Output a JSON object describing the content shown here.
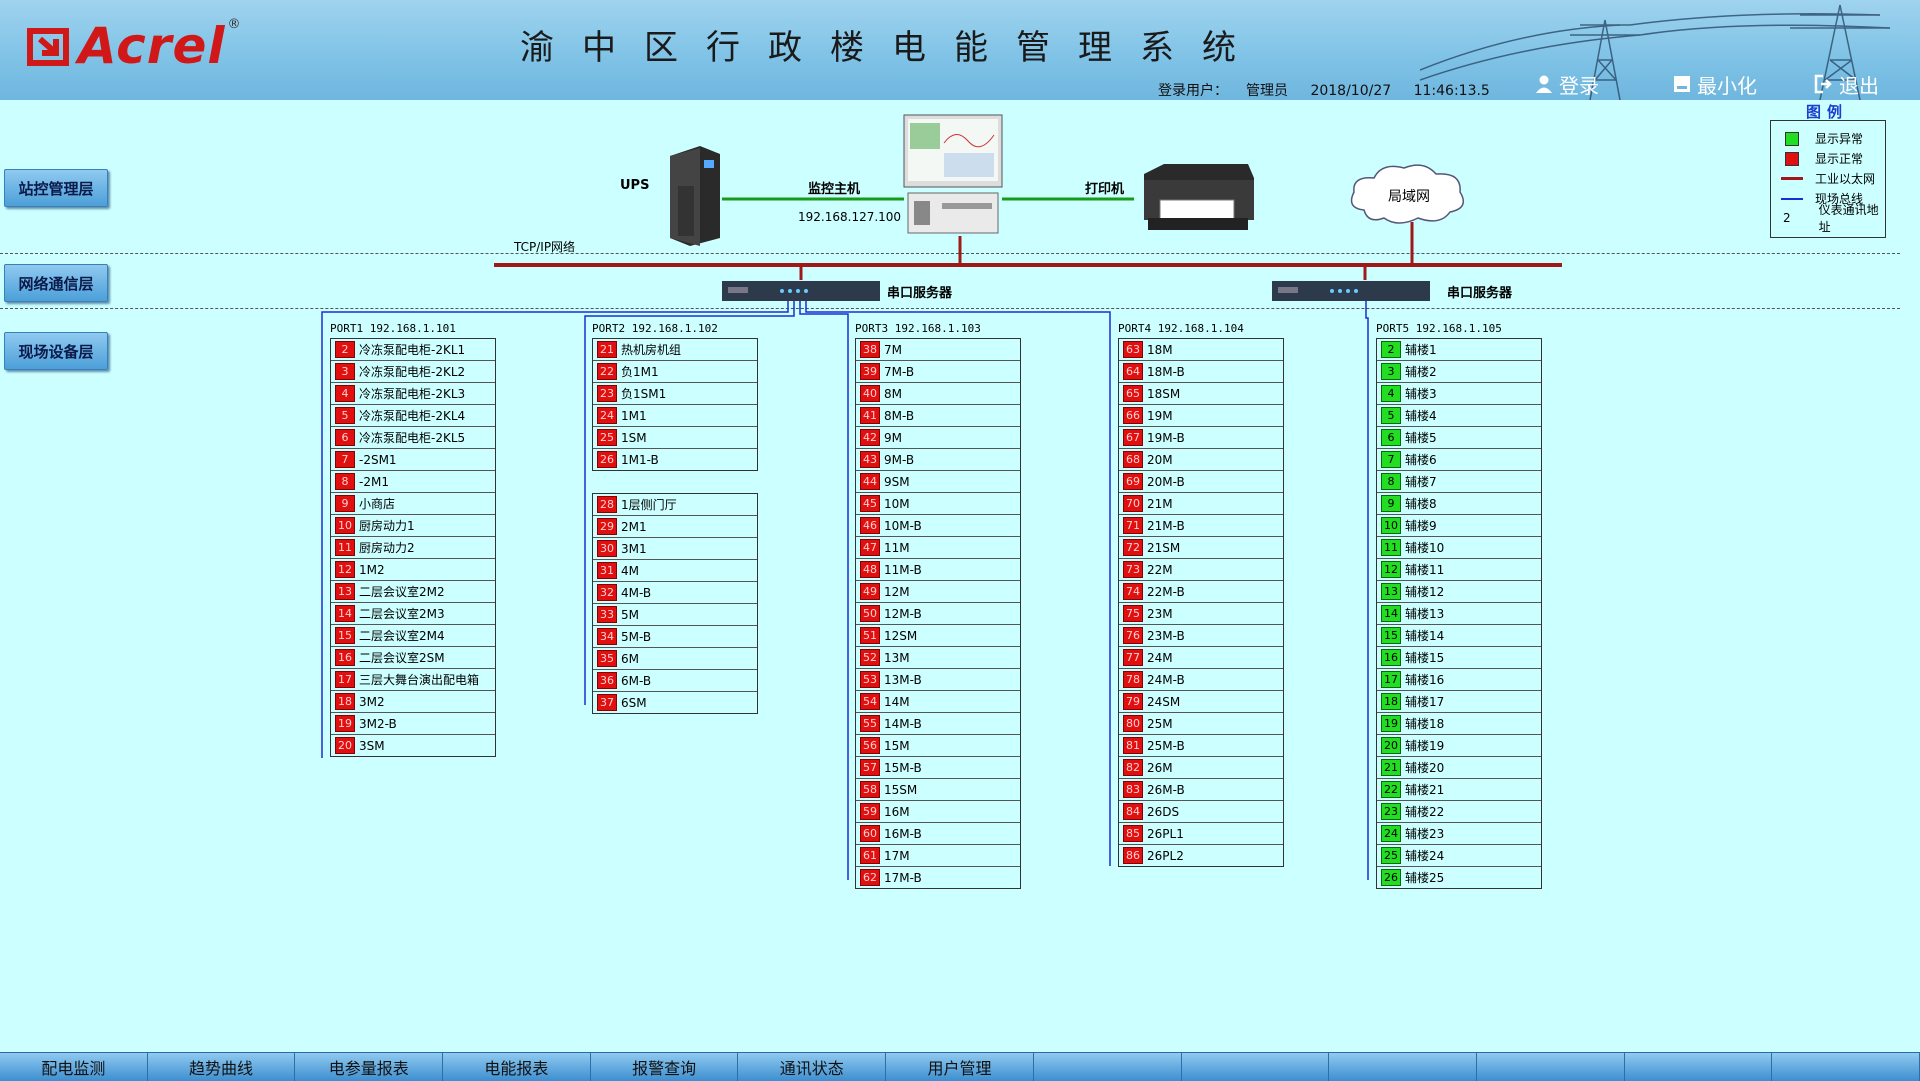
{
  "header": {
    "brand": "Acrel",
    "reg_mark": "®",
    "title": "渝中区行政楼电能管理系统",
    "user_label": "登录用户：",
    "user_name": "管理员",
    "date": "2018/10/27",
    "time": "11:46:13.5",
    "login_label": "登录",
    "minimize_label": "最小化",
    "exit_label": "退出"
  },
  "layers": {
    "station": "站控管理层",
    "network": "网络通信层",
    "field": "现场设备层"
  },
  "equipment": {
    "ups_label": "UPS",
    "host_label": "监控主机",
    "host_ip": "192.168.127.100",
    "printer_label": "打印机",
    "lan_label": "局域网",
    "tcpip_label": "TCP/IP网络",
    "serial_server_1": "串口服务器",
    "serial_server_2": "串口服务器"
  },
  "legend": {
    "title": "图例",
    "items": [
      {
        "symbol": "green-square",
        "label": "显示异常"
      },
      {
        "symbol": "red-square",
        "label": "显示正常"
      },
      {
        "symbol": "red-line",
        "label": "工业以太网"
      },
      {
        "symbol": "blue-line",
        "label": "现场总线"
      },
      {
        "symbol": "2",
        "label": "仪表通讯地址"
      }
    ]
  },
  "colors": {
    "status_red": "#e01010",
    "status_green": "#22dd22",
    "ethernet": "#a01818",
    "fieldbus": "#1a2fd0",
    "background": "#ccffff"
  },
  "ports": [
    {
      "title": "PORT1 192.168.1.101",
      "groups": [
        [
          {
            "n": "2",
            "t": "冷冻泵配电柜-2KL1",
            "s": "red"
          },
          {
            "n": "3",
            "t": "冷冻泵配电柜-2KL2",
            "s": "red"
          },
          {
            "n": "4",
            "t": "冷冻泵配电柜-2KL3",
            "s": "red"
          },
          {
            "n": "5",
            "t": "冷冻泵配电柜-2KL4",
            "s": "red"
          },
          {
            "n": "6",
            "t": "冷冻泵配电柜-2KL5",
            "s": "red"
          },
          {
            "n": "7",
            "t": "-2SM1",
            "s": "red"
          },
          {
            "n": "8",
            "t": "-2M1",
            "s": "red"
          },
          {
            "n": "9",
            "t": "小商店",
            "s": "red"
          },
          {
            "n": "10",
            "t": "厨房动力1",
            "s": "red"
          },
          {
            "n": "11",
            "t": "厨房动力2",
            "s": "red"
          },
          {
            "n": "12",
            "t": "1M2",
            "s": "red"
          },
          {
            "n": "13",
            "t": "二层会议室2M2",
            "s": "red"
          },
          {
            "n": "14",
            "t": "二层会议室2M3",
            "s": "red"
          },
          {
            "n": "15",
            "t": "二层会议室2M4",
            "s": "red"
          },
          {
            "n": "16",
            "t": "二层会议室2SM",
            "s": "red"
          },
          {
            "n": "17",
            "t": "三层大舞台演出配电箱",
            "s": "red"
          },
          {
            "n": "18",
            "t": "3M2",
            "s": "red"
          },
          {
            "n": "19",
            "t": "3M2-B",
            "s": "red"
          },
          {
            "n": "20",
            "t": "3SM",
            "s": "red"
          }
        ]
      ]
    },
    {
      "title": "PORT2 192.168.1.102",
      "groups": [
        [
          {
            "n": "21",
            "t": "热机房机组",
            "s": "red"
          },
          {
            "n": "22",
            "t": "负1M1",
            "s": "red"
          },
          {
            "n": "23",
            "t": "负1SM1",
            "s": "red"
          },
          {
            "n": "24",
            "t": "1M1",
            "s": "red"
          },
          {
            "n": "25",
            "t": "1SM",
            "s": "red"
          },
          {
            "n": "26",
            "t": "1M1-B",
            "s": "red"
          }
        ],
        [
          {
            "n": "28",
            "t": "1层侧门厅",
            "s": "red"
          },
          {
            "n": "29",
            "t": "2M1",
            "s": "red"
          },
          {
            "n": "30",
            "t": "3M1",
            "s": "red"
          },
          {
            "n": "31",
            "t": "4M",
            "s": "red"
          },
          {
            "n": "32",
            "t": "4M-B",
            "s": "red"
          },
          {
            "n": "33",
            "t": "5M",
            "s": "red"
          },
          {
            "n": "34",
            "t": "5M-B",
            "s": "red"
          },
          {
            "n": "35",
            "t": "6M",
            "s": "red"
          },
          {
            "n": "36",
            "t": "6M-B",
            "s": "red"
          },
          {
            "n": "37",
            "t": "6SM",
            "s": "red"
          }
        ]
      ]
    },
    {
      "title": "PORT3 192.168.1.103",
      "groups": [
        [
          {
            "n": "38",
            "t": "7M",
            "s": "red"
          },
          {
            "n": "39",
            "t": "7M-B",
            "s": "red"
          },
          {
            "n": "40",
            "t": "8M",
            "s": "red"
          },
          {
            "n": "41",
            "t": "8M-B",
            "s": "red"
          },
          {
            "n": "42",
            "t": "9M",
            "s": "red"
          },
          {
            "n": "43",
            "t": "9M-B",
            "s": "red"
          },
          {
            "n": "44",
            "t": "9SM",
            "s": "red"
          },
          {
            "n": "45",
            "t": "10M",
            "s": "red"
          },
          {
            "n": "46",
            "t": "10M-B",
            "s": "red"
          },
          {
            "n": "47",
            "t": "11M",
            "s": "red"
          },
          {
            "n": "48",
            "t": "11M-B",
            "s": "red"
          },
          {
            "n": "49",
            "t": "12M",
            "s": "red"
          },
          {
            "n": "50",
            "t": "12M-B",
            "s": "red"
          },
          {
            "n": "51",
            "t": "12SM",
            "s": "red"
          },
          {
            "n": "52",
            "t": "13M",
            "s": "red"
          },
          {
            "n": "53",
            "t": "13M-B",
            "s": "red"
          },
          {
            "n": "54",
            "t": "14M",
            "s": "red"
          },
          {
            "n": "55",
            "t": "14M-B",
            "s": "red"
          },
          {
            "n": "56",
            "t": "15M",
            "s": "red"
          },
          {
            "n": "57",
            "t": "15M-B",
            "s": "red"
          },
          {
            "n": "58",
            "t": "15SM",
            "s": "red"
          },
          {
            "n": "59",
            "t": "16M",
            "s": "red"
          },
          {
            "n": "60",
            "t": "16M-B",
            "s": "red"
          },
          {
            "n": "61",
            "t": "17M",
            "s": "red"
          },
          {
            "n": "62",
            "t": "17M-B",
            "s": "red"
          }
        ]
      ]
    },
    {
      "title": "PORT4 192.168.1.104",
      "groups": [
        [
          {
            "n": "63",
            "t": "18M",
            "s": "red"
          },
          {
            "n": "64",
            "t": "18M-B",
            "s": "red"
          },
          {
            "n": "65",
            "t": "18SM",
            "s": "red"
          },
          {
            "n": "66",
            "t": "19M",
            "s": "red"
          },
          {
            "n": "67",
            "t": "19M-B",
            "s": "red"
          },
          {
            "n": "68",
            "t": "20M",
            "s": "red"
          },
          {
            "n": "69",
            "t": "20M-B",
            "s": "red"
          },
          {
            "n": "70",
            "t": "21M",
            "s": "red"
          },
          {
            "n": "71",
            "t": "21M-B",
            "s": "red"
          },
          {
            "n": "72",
            "t": "21SM",
            "s": "red"
          },
          {
            "n": "73",
            "t": "22M",
            "s": "red"
          },
          {
            "n": "74",
            "t": "22M-B",
            "s": "red"
          },
          {
            "n": "75",
            "t": "23M",
            "s": "red"
          },
          {
            "n": "76",
            "t": "23M-B",
            "s": "red"
          },
          {
            "n": "77",
            "t": "24M",
            "s": "red"
          },
          {
            "n": "78",
            "t": "24M-B",
            "s": "red"
          },
          {
            "n": "79",
            "t": "24SM",
            "s": "red"
          },
          {
            "n": "80",
            "t": "25M",
            "s": "red"
          },
          {
            "n": "81",
            "t": "25M-B",
            "s": "red"
          },
          {
            "n": "82",
            "t": "26M",
            "s": "red"
          },
          {
            "n": "83",
            "t": "26M-B",
            "s": "red"
          },
          {
            "n": "84",
            "t": "26DS",
            "s": "red"
          },
          {
            "n": "85",
            "t": "26PL1",
            "s": "red"
          },
          {
            "n": "86",
            "t": "26PL2",
            "s": "red"
          }
        ]
      ]
    },
    {
      "title": "PORT5 192.168.1.105",
      "groups": [
        [
          {
            "n": "2",
            "t": "辅楼1",
            "s": "green"
          },
          {
            "n": "3",
            "t": "辅楼2",
            "s": "green"
          },
          {
            "n": "4",
            "t": "辅楼3",
            "s": "green"
          },
          {
            "n": "5",
            "t": "辅楼4",
            "s": "green"
          },
          {
            "n": "6",
            "t": "辅楼5",
            "s": "green"
          },
          {
            "n": "7",
            "t": "辅楼6",
            "s": "green"
          },
          {
            "n": "8",
            "t": "辅楼7",
            "s": "green"
          },
          {
            "n": "9",
            "t": "辅楼8",
            "s": "green"
          },
          {
            "n": "10",
            "t": "辅楼9",
            "s": "green"
          },
          {
            "n": "11",
            "t": "辅楼10",
            "s": "green"
          },
          {
            "n": "12",
            "t": "辅楼11",
            "s": "green"
          },
          {
            "n": "13",
            "t": "辅楼12",
            "s": "green"
          },
          {
            "n": "14",
            "t": "辅楼13",
            "s": "green"
          },
          {
            "n": "15",
            "t": "辅楼14",
            "s": "green"
          },
          {
            "n": "16",
            "t": "辅楼15",
            "s": "green"
          },
          {
            "n": "17",
            "t": "辅楼16",
            "s": "green"
          },
          {
            "n": "18",
            "t": "辅楼17",
            "s": "green"
          },
          {
            "n": "19",
            "t": "辅楼18",
            "s": "green"
          },
          {
            "n": "20",
            "t": "辅楼19",
            "s": "green"
          },
          {
            "n": "21",
            "t": "辅楼20",
            "s": "green"
          },
          {
            "n": "22",
            "t": "辅楼21",
            "s": "green"
          },
          {
            "n": "23",
            "t": "辅楼22",
            "s": "green"
          },
          {
            "n": "24",
            "t": "辅楼23",
            "s": "green"
          },
          {
            "n": "25",
            "t": "辅楼24",
            "s": "green"
          },
          {
            "n": "26",
            "t": "辅楼25",
            "s": "green"
          }
        ]
      ]
    }
  ],
  "nav": [
    "配电监测",
    "趋势曲线",
    "电参量报表",
    "电能报表",
    "报警查询",
    "通讯状态",
    "用户管理",
    "",
    "",
    "",
    "",
    "",
    ""
  ]
}
